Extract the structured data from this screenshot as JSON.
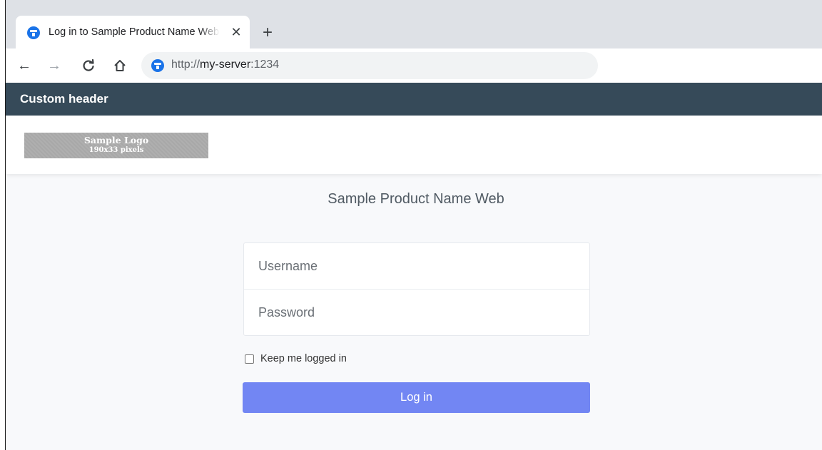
{
  "browser": {
    "tab": {
      "title": "Log in to Sample Product Name Web",
      "close_glyph": "✕"
    },
    "new_tab_glyph": "+",
    "toolbar": {
      "back_glyph": "←",
      "forward_glyph": "→"
    },
    "address": {
      "scheme": "http://",
      "host": "my-server",
      "port": ":1234"
    }
  },
  "page": {
    "custom_header": "Custom header",
    "logo": {
      "line1": "Sample Logo",
      "line2": "190x33 pixels"
    },
    "product_name": "Sample Product Name Web",
    "form": {
      "username_placeholder": "Username",
      "password_placeholder": "Password",
      "remember_label": "Keep me logged in",
      "remember_checked": false,
      "submit_label": "Log in"
    }
  },
  "colors": {
    "header_bg": "#364a59",
    "button_bg": "#7286f3",
    "tabstrip_bg": "#dee1e6",
    "favicon": "#1a73e8"
  }
}
